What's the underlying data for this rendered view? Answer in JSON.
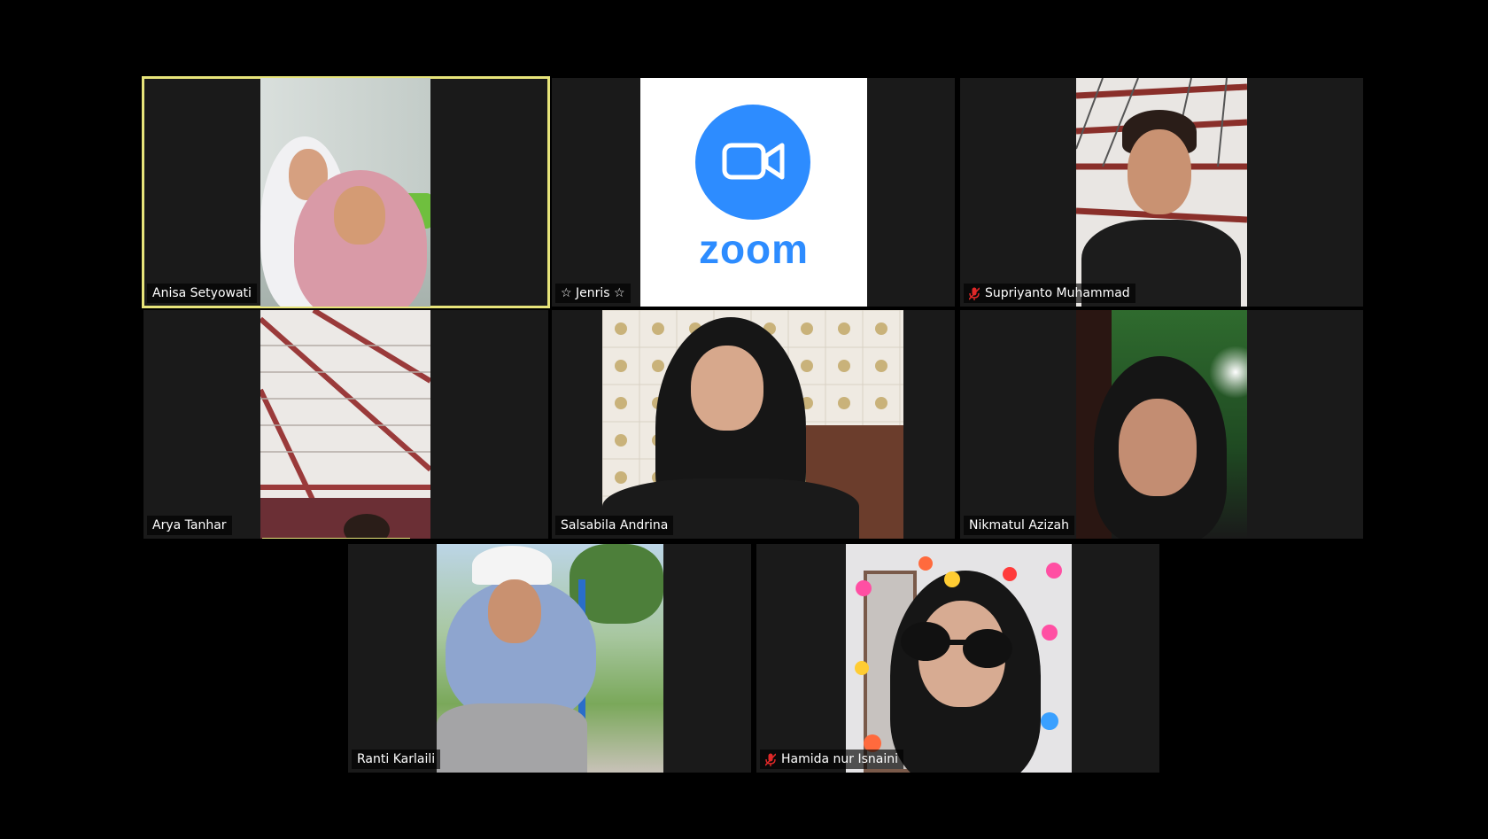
{
  "app": {
    "name": "Zoom"
  },
  "zoom_placeholder": {
    "logo_text": "zoom"
  },
  "participants": [
    {
      "name": "Anisa Setyowati",
      "muted": false,
      "active_speaker": true,
      "video": "two-girls-hijab"
    },
    {
      "name": "☆ Jenris ☆",
      "muted": false,
      "active_speaker": false,
      "video": "zoom-logo"
    },
    {
      "name": "Supriyanto Muhammad",
      "muted": true,
      "active_speaker": false,
      "video": "young-man"
    },
    {
      "name": "Arya Tanhar",
      "muted": false,
      "active_speaker": false,
      "video": "ceiling"
    },
    {
      "name": "Salsabila Andrina",
      "muted": false,
      "active_speaker": false,
      "video": "girl-black-hijab-tiles"
    },
    {
      "name": "Nikmatul Azizah",
      "muted": false,
      "active_speaker": false,
      "video": "girl-black-hijab-green"
    },
    {
      "name": "Ranti Karlaili",
      "muted": false,
      "active_speaker": false,
      "video": "girl-blue-hijab-outdoor"
    },
    {
      "name": "Hamida nur Isnaini",
      "muted": true,
      "active_speaker": false,
      "video": "girl-sunglasses-emoji"
    }
  ],
  "colors": {
    "background": "#000000",
    "tile": "#1a1a1a",
    "active_border": "#e7e47a",
    "zoom_blue": "#2d8cff",
    "muted_red": "#e02828"
  }
}
